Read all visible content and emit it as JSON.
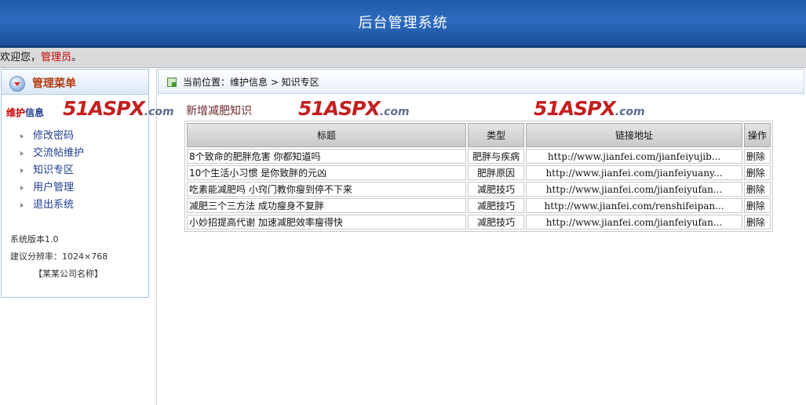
{
  "header": {
    "title": "后台管理系统"
  },
  "welcome": {
    "prefix": "欢迎您，",
    "user": "管理员",
    "suffix": "。"
  },
  "sidebar": {
    "menu_title": "管理菜单",
    "section": {
      "part1": "维护",
      "part2": "信息"
    },
    "items": [
      {
        "label": "修改密码"
      },
      {
        "label": "交流帖维护"
      },
      {
        "label": "知识专区"
      },
      {
        "label": "用户管理"
      },
      {
        "label": "退出系统"
      }
    ],
    "version": "系统版本1.0",
    "resolution": "建议分辨率：1024×768",
    "company": "【某某公司名称】"
  },
  "watermark": {
    "main": "51ASPX",
    "suffix": ".com"
  },
  "breadcrumb": {
    "text": "当前位置：维护信息 > 知识专区"
  },
  "main": {
    "add_link": "新增减肥知识",
    "table": {
      "headers": [
        "标题",
        "类型",
        "链接地址",
        "操作"
      ],
      "rows": [
        {
          "title": "8个致命的肥胖危害 你都知道吗",
          "type": "肥胖与疾病",
          "url": "http://www.jianfei.com/jianfeiyujib...",
          "action": "删除"
        },
        {
          "title": "10个生活小习惯 是你致胖的元凶",
          "type": "肥胖原因",
          "url": "http://www.jianfei.com/jianfeiyuany...",
          "action": "删除"
        },
        {
          "title": "吃素能减肥吗 小窍门教你瘦到停不下来",
          "type": "减肥技巧",
          "url": "http://www.jianfei.com/jianfeiyufan...",
          "action": "删除"
        },
        {
          "title": "减肥三个三方法 成功瘦身不复胖",
          "type": "减肥技巧",
          "url": "http://www.jianfei.com/renshifeipan...",
          "action": "删除"
        },
        {
          "title": "小妙招提高代谢 加速减肥效率瘦得快",
          "type": "减肥技巧",
          "url": "http://www.jianfei.com/jianfeiyufan...",
          "action": "删除"
        }
      ]
    }
  }
}
